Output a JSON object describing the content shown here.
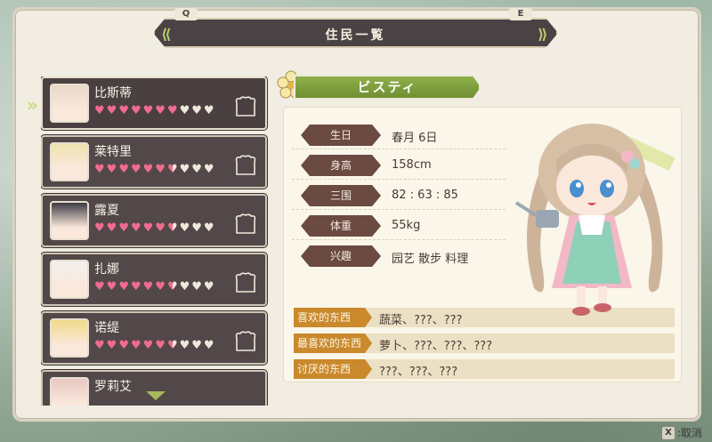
{
  "header": {
    "title": "住民一覧",
    "prev_key": "Q",
    "next_key": "E"
  },
  "residents": [
    {
      "name": "比斯蒂",
      "hearts": [
        "full",
        "full",
        "full",
        "full",
        "full",
        "full",
        "full",
        "empty",
        "empty",
        "empty"
      ],
      "selected": true
    },
    {
      "name": "莱特里",
      "hearts": [
        "full",
        "full",
        "full",
        "full",
        "full",
        "full",
        "half",
        "empty",
        "empty",
        "empty"
      ],
      "selected": false
    },
    {
      "name": "露夏",
      "hearts": [
        "full",
        "full",
        "full",
        "full",
        "full",
        "full",
        "half",
        "empty",
        "empty",
        "empty"
      ],
      "selected": false
    },
    {
      "name": "扎娜",
      "hearts": [
        "full",
        "full",
        "full",
        "full",
        "full",
        "full",
        "half",
        "empty",
        "empty",
        "empty"
      ],
      "selected": false
    },
    {
      "name": "诺缇",
      "hearts": [
        "full",
        "full",
        "full",
        "full",
        "full",
        "full",
        "half",
        "empty",
        "empty",
        "empty"
      ],
      "selected": false
    },
    {
      "name": "罗莉艾",
      "hearts": [],
      "selected": false
    }
  ],
  "profile": {
    "name": "ビスティ",
    "stats": [
      {
        "label": "生日",
        "value": "春月 6日"
      },
      {
        "label": "身高",
        "value": "158cm"
      },
      {
        "label": "三围",
        "value": "82 : 63 : 85"
      },
      {
        "label": "体重",
        "value": "55kg"
      },
      {
        "label": "兴趣",
        "value": "园艺 散步 料理"
      }
    ],
    "preferences": [
      {
        "label": "喜欢的东西",
        "value": "蔬菜、???、???"
      },
      {
        "label": "最喜欢的东西",
        "value": "萝卜、???、???、???"
      },
      {
        "label": "讨厌的东西",
        "value": "???、???、???"
      }
    ]
  },
  "footer": {
    "cancel_key": "X",
    "cancel_label": ":取消"
  },
  "colors": {
    "heart_full": "#f06c8f",
    "heart_empty": "#efe8da",
    "card_bg": "#524749",
    "name_banner": "#7fa03e",
    "stat_label": "#6b4a42",
    "pref_label": "#c9892c"
  }
}
